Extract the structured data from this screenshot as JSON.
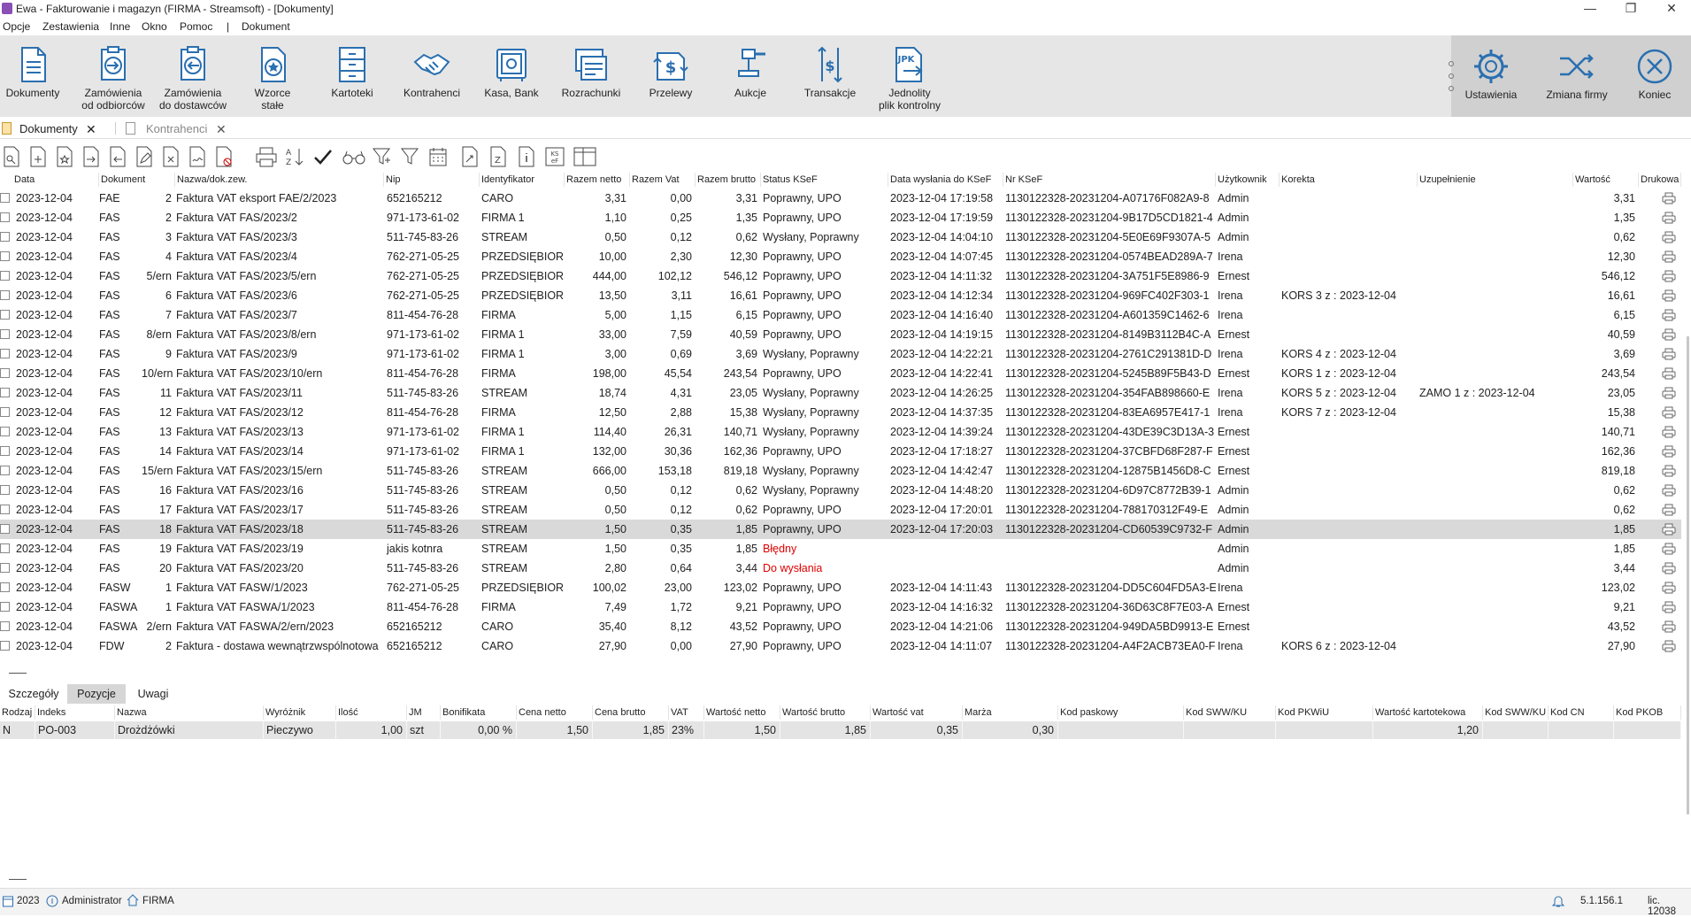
{
  "window": {
    "title": "Ewa - Fakturowanie i magazyn (FIRMA - Streamsoft) - [Dokumenty]",
    "minimize": "—",
    "maximize": "❐",
    "close": "✕"
  },
  "menu": [
    "Opcje",
    "Zestawienia",
    "Inne",
    "Okno",
    "Pomoc",
    "|",
    "Dokument"
  ],
  "ribbon": [
    {
      "line1": "Dokumenty",
      "line2": "",
      "icon": "document-icon"
    },
    {
      "line1": "Zamówienia",
      "line2": "od odbiorców",
      "icon": "orders-in-icon"
    },
    {
      "line1": "Zamówienia",
      "line2": "do dostawców",
      "icon": "orders-out-icon"
    },
    {
      "line1": "Wzorce",
      "line2": "stałe",
      "icon": "template-icon"
    },
    {
      "line1": "Kartoteki",
      "line2": "",
      "icon": "cabinet-icon"
    },
    {
      "line1": "Kontrahenci",
      "line2": "",
      "icon": "handshake-icon"
    },
    {
      "line1": "Kasa, Bank",
      "line2": "",
      "icon": "safe-icon"
    },
    {
      "line1": "Rozrachunki",
      "line2": "",
      "icon": "settlements-icon"
    },
    {
      "line1": "Przelewy",
      "line2": "",
      "icon": "transfer-icon"
    },
    {
      "line1": "Aukcje",
      "line2": "",
      "icon": "gavel-icon"
    },
    {
      "line1": "Transakcje",
      "line2": "",
      "icon": "transactions-icon"
    },
    {
      "line1": "Jednolity",
      "line2": "plik kontrolny",
      "icon": "jpk-icon"
    }
  ],
  "ribbon_right": [
    {
      "label": "Ustawienia",
      "icon": "gear-icon"
    },
    {
      "label": "Zmiana firmy",
      "icon": "shuffle-icon"
    },
    {
      "label": "Koniec",
      "icon": "close-circle-icon"
    }
  ],
  "tabs": [
    {
      "label": "Dokumenty",
      "active": true
    },
    {
      "label": "Kontrahenci",
      "active": false
    }
  ],
  "grid": {
    "headers": [
      "Data",
      "Dokument",
      "Nazwa/dok.zew.",
      "Nip",
      "Identyfikator",
      "Razem netto",
      "Razem Vat",
      "Razem brutto",
      "Status KSeF",
      "Data wysłania do KSeF",
      "Nr KSeF",
      "Użytkownik",
      "Korekta",
      "Uzupełnienie",
      "Wartość",
      "Drukowa"
    ],
    "rows": [
      [
        "2023-12-04",
        "FAE",
        "2",
        "Faktura VAT eksport FAE/2/2023",
        "652165212",
        "CARO",
        "3,31",
        "0,00",
        "3,31",
        "Poprawny, UPO",
        "2023-12-04 17:19:58",
        "1130122328-20231204-A07176F082A9-8",
        "Admin",
        "",
        "",
        "3,31"
      ],
      [
        "2023-12-04",
        "FAS",
        "2",
        "Faktura VAT FAS/2023/2",
        "971-173-61-02",
        "FIRMA 1",
        "1,10",
        "0,25",
        "1,35",
        "Poprawny, UPO",
        "2023-12-04 17:19:59",
        "1130122328-20231204-9B17D5CD1821-4",
        "Admin",
        "",
        "",
        "1,35"
      ],
      [
        "2023-12-04",
        "FAS",
        "3",
        "Faktura VAT FAS/2023/3",
        "511-745-83-26",
        "STREAM",
        "0,50",
        "0,12",
        "0,62",
        "Wysłany, Poprawny",
        "2023-12-04 14:04:10",
        "1130122328-20231204-5E0E69F9307A-5",
        "Admin",
        "",
        "",
        "0,62"
      ],
      [
        "2023-12-04",
        "FAS",
        "4",
        "Faktura VAT FAS/2023/4",
        "762-271-05-25",
        "PRZEDSIĘBIORS",
        "10,00",
        "2,30",
        "12,30",
        "Poprawny, UPO",
        "2023-12-04 14:07:45",
        "1130122328-20231204-0574BEAD289A-7",
        "Irena",
        "",
        "",
        "12,30"
      ],
      [
        "2023-12-04",
        "FAS",
        "5/ern",
        "Faktura VAT FAS/2023/5/ern",
        "762-271-05-25",
        "PRZEDSIĘBIORS",
        "444,00",
        "102,12",
        "546,12",
        "Poprawny, UPO",
        "2023-12-04 14:11:32",
        "1130122328-20231204-3A751F5E8986-9",
        "Ernest",
        "",
        "",
        "546,12"
      ],
      [
        "2023-12-04",
        "FAS",
        "6",
        "Faktura VAT FAS/2023/6",
        "762-271-05-25",
        "PRZEDSIĘBIORS",
        "13,50",
        "3,11",
        "16,61",
        "Poprawny, UPO",
        "2023-12-04 14:12:34",
        "1130122328-20231204-969FC402F303-1",
        "Irena",
        "KORS 3 z : 2023-12-04",
        "",
        "16,61"
      ],
      [
        "2023-12-04",
        "FAS",
        "7",
        "Faktura VAT FAS/2023/7",
        "811-454-76-28",
        "FIRMA",
        "5,00",
        "1,15",
        "6,15",
        "Poprawny, UPO",
        "2023-12-04 14:16:40",
        "1130122328-20231204-A601359C1462-6",
        "Irena",
        "",
        "",
        "6,15"
      ],
      [
        "2023-12-04",
        "FAS",
        "8/ern",
        "Faktura VAT FAS/2023/8/ern",
        "971-173-61-02",
        "FIRMA 1",
        "33,00",
        "7,59",
        "40,59",
        "Poprawny, UPO",
        "2023-12-04 14:19:15",
        "1130122328-20231204-8149B3112B4C-A",
        "Ernest",
        "",
        "",
        "40,59"
      ],
      [
        "2023-12-04",
        "FAS",
        "9",
        "Faktura VAT FAS/2023/9",
        "971-173-61-02",
        "FIRMA 1",
        "3,00",
        "0,69",
        "3,69",
        "Wysłany, Poprawny",
        "2023-12-04 14:22:21",
        "1130122328-20231204-2761C291381D-D",
        "Irena",
        "KORS 4 z : 2023-12-04",
        "",
        "3,69"
      ],
      [
        "2023-12-04",
        "FAS",
        "10/ern",
        "Faktura VAT FAS/2023/10/ern",
        "811-454-76-28",
        "FIRMA",
        "198,00",
        "45,54",
        "243,54",
        "Poprawny, UPO",
        "2023-12-04 14:22:41",
        "1130122328-20231204-5245B89F5B43-D",
        "Ernest",
        "KORS 1 z : 2023-12-04",
        "",
        "243,54"
      ],
      [
        "2023-12-04",
        "FAS",
        "11",
        "Faktura VAT FAS/2023/11",
        "511-745-83-26",
        "STREAM",
        "18,74",
        "4,31",
        "23,05",
        "Wysłany, Poprawny",
        "2023-12-04 14:26:25",
        "1130122328-20231204-354FAB898660-E",
        "Irena",
        "KORS 5 z : 2023-12-04",
        "ZAMO 1 z : 2023-12-04",
        "23,05"
      ],
      [
        "2023-12-04",
        "FAS",
        "12",
        "Faktura VAT FAS/2023/12",
        "811-454-76-28",
        "FIRMA",
        "12,50",
        "2,88",
        "15,38",
        "Wysłany, Poprawny",
        "2023-12-04 14:37:35",
        "1130122328-20231204-83EA6957E417-1",
        "Irena",
        "KORS 7 z : 2023-12-04",
        "",
        "15,38"
      ],
      [
        "2023-12-04",
        "FAS",
        "13",
        "Faktura VAT FAS/2023/13",
        "971-173-61-02",
        "FIRMA 1",
        "114,40",
        "26,31",
        "140,71",
        "Wysłany, Poprawny",
        "2023-12-04 14:39:24",
        "1130122328-20231204-43DE39C3D13A-3",
        "Ernest",
        "",
        "",
        "140,71"
      ],
      [
        "2023-12-04",
        "FAS",
        "14",
        "Faktura VAT FAS/2023/14",
        "971-173-61-02",
        "FIRMA 1",
        "132,00",
        "30,36",
        "162,36",
        "Poprawny, UPO",
        "2023-12-04 17:18:27",
        "1130122328-20231204-37CBFD68F287-F",
        "Ernest",
        "",
        "",
        "162,36"
      ],
      [
        "2023-12-04",
        "FAS",
        "15/ern",
        "Faktura VAT FAS/2023/15/ern",
        "511-745-83-26",
        "STREAM",
        "666,00",
        "153,18",
        "819,18",
        "Wysłany, Poprawny",
        "2023-12-04 14:42:47",
        "1130122328-20231204-12875B1456D8-C",
        "Ernest",
        "",
        "",
        "819,18"
      ],
      [
        "2023-12-04",
        "FAS",
        "16",
        "Faktura VAT FAS/2023/16",
        "511-745-83-26",
        "STREAM",
        "0,50",
        "0,12",
        "0,62",
        "Wysłany, Poprawny",
        "2023-12-04 14:48:20",
        "1130122328-20231204-6D97C8772B39-1",
        "Admin",
        "",
        "",
        "0,62"
      ],
      [
        "2023-12-04",
        "FAS",
        "17",
        "Faktura VAT FAS/2023/17",
        "511-745-83-26",
        "STREAM",
        "0,50",
        "0,12",
        "0,62",
        "Poprawny, UPO",
        "2023-12-04 17:20:01",
        "1130122328-20231204-788170312F49-E",
        "Admin",
        "",
        "",
        "0,62"
      ],
      [
        "2023-12-04",
        "FAS",
        "18",
        "Faktura VAT FAS/2023/18",
        "511-745-83-26",
        "STREAM",
        "1,50",
        "0,35",
        "1,85",
        "Poprawny, UPO",
        "2023-12-04 17:20:03",
        "1130122328-20231204-CD60539C9732-F",
        "Admin",
        "",
        "",
        "1,85"
      ],
      [
        "2023-12-04",
        "FAS",
        "19",
        "Faktura VAT FAS/2023/19",
        "jakis kotnra",
        "STREAM",
        "1,50",
        "0,35",
        "1,85",
        "Błędny",
        "",
        "",
        "Admin",
        "",
        "",
        "1,85"
      ],
      [
        "2023-12-04",
        "FAS",
        "20",
        "Faktura VAT FAS/2023/20",
        "511-745-83-26",
        "STREAM",
        "2,80",
        "0,64",
        "3,44",
        "Do wysłania",
        "",
        "",
        "Admin",
        "",
        "",
        "3,44"
      ],
      [
        "2023-12-04",
        "FASW",
        "1",
        "Faktura VAT FASW/1/2023",
        "762-271-05-25",
        "PRZEDSIĘBIORS",
        "100,02",
        "23,00",
        "123,02",
        "Poprawny, UPO",
        "2023-12-04 14:11:43",
        "1130122328-20231204-DD5C604FD5A3-E",
        "Irena",
        "",
        "",
        "123,02"
      ],
      [
        "2023-12-04",
        "FASWA",
        "1",
        "Faktura VAT FASWA/1/2023",
        "811-454-76-28",
        "FIRMA",
        "7,49",
        "1,72",
        "9,21",
        "Poprawny, UPO",
        "2023-12-04 14:16:32",
        "1130122328-20231204-36D63C8F7E03-A",
        "Ernest",
        "",
        "",
        "9,21"
      ],
      [
        "2023-12-04",
        "FASWA",
        "2/ern",
        "Faktura VAT FASWA/2/ern/2023",
        "652165212",
        "CARO",
        "35,40",
        "8,12",
        "43,52",
        "Poprawny, UPO",
        "2023-12-04 14:21:06",
        "1130122328-20231204-949DA5BD9913-E",
        "Ernest",
        "",
        "",
        "43,52"
      ],
      [
        "2023-12-04",
        "FDW",
        "2",
        "Faktura - dostawa wewnątrzwspólnotowa",
        "652165212",
        "CARO",
        "27,90",
        "0,00",
        "27,90",
        "Poprawny, UPO",
        "2023-12-04 14:11:07",
        "1130122328-20231204-A4F2ACB73EA0-F",
        "Irena",
        "KORS 6 z : 2023-12-04",
        "",
        "27,90"
      ]
    ],
    "selected_row": 17,
    "error_status_color": "#e00000"
  },
  "bottom_tabs": [
    {
      "label": "Szczegóły",
      "active": false
    },
    {
      "label": "Pozycje",
      "active": true
    },
    {
      "label": "Uwagi",
      "active": false
    }
  ],
  "positions": {
    "headers": [
      "Rodzaj",
      "Indeks",
      "Nazwa",
      "Wyróżnik",
      "Ilość",
      "JM",
      "Bonifikata",
      "Cena netto",
      "Cena brutto",
      "VAT",
      "Wartość netto",
      "Wartość brutto",
      "Wartość vat",
      "Marża",
      "Kod paskowy",
      "Kod SWW/KU",
      "Kod PKWiU",
      "Wartość kartotekowa",
      "Kod SWW/KU",
      "Kod CN",
      "Kod PKOB"
    ],
    "row": [
      "N",
      "PO-003",
      "Drożdżówki",
      "Pieczywo",
      "1,00",
      "szt",
      "0,00 %",
      "1,50",
      "1,85",
      "23%",
      "1,50",
      "1,85",
      "0,35",
      "0,30",
      "",
      "",
      "",
      "1,20",
      "",
      "",
      ""
    ]
  },
  "statusbar": {
    "year": "2023",
    "user": "Administrator",
    "company": "FIRMA",
    "version": "5.1.156.1",
    "license": "lic. 12038"
  }
}
